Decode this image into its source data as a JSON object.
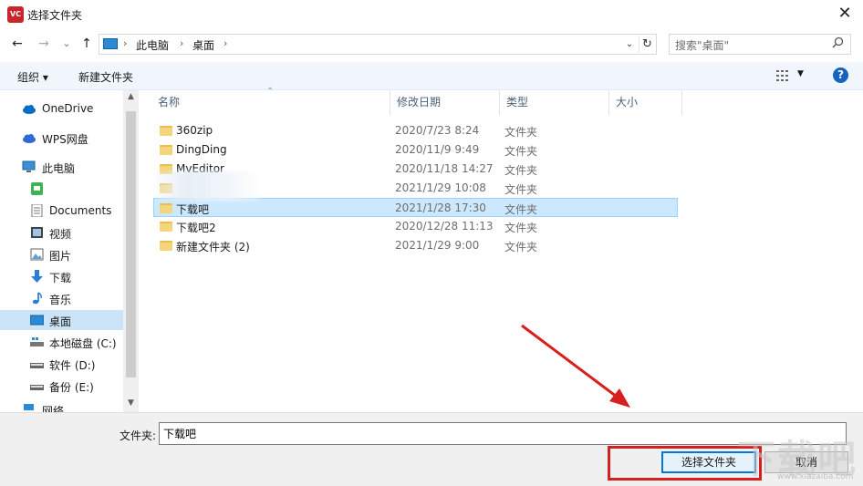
{
  "window": {
    "title": "选择文件夹",
    "app_icon_text": "VC",
    "close_glyph": "✕"
  },
  "nav": {
    "back": "←",
    "forward": "→",
    "recent": "⌄",
    "up": "↑",
    "breadcrumb": [
      "此电脑",
      "桌面"
    ],
    "search_placeholder": "搜索\"桌面\""
  },
  "toolbar": {
    "organize": "组织 ▾",
    "new_folder": "新建文件夹",
    "help": "?"
  },
  "sidebar": {
    "items": [
      {
        "label": "OneDrive",
        "icon": "cloud-icon"
      },
      {
        "label": "WPS网盘",
        "icon": "cloud-icon"
      },
      {
        "label": "此电脑",
        "icon": "computer-icon"
      },
      {
        "label": "",
        "icon": "wechat-icon"
      },
      {
        "label": "Documents",
        "icon": "document-icon"
      },
      {
        "label": "视频",
        "icon": "video-icon"
      },
      {
        "label": "图片",
        "icon": "picture-icon"
      },
      {
        "label": "下载",
        "icon": "download-icon"
      },
      {
        "label": "音乐",
        "icon": "music-icon"
      },
      {
        "label": "桌面",
        "icon": "desktop-icon",
        "selected": true
      },
      {
        "label": "本地磁盘 (C:)",
        "icon": "drive-icon"
      },
      {
        "label": "软件 (D:)",
        "icon": "drive-icon"
      },
      {
        "label": "备份 (E:)",
        "icon": "drive-icon"
      },
      {
        "label": "网络",
        "icon": "network-icon"
      }
    ]
  },
  "columns": {
    "name": "名称",
    "modified": "修改日期",
    "type": "类型",
    "size": "大小"
  },
  "files": [
    {
      "name": "360zip",
      "modified": "2020/7/23 8:24",
      "type": "文件夹"
    },
    {
      "name": "DingDing",
      "modified": "2020/11/9 9:49",
      "type": "文件夹"
    },
    {
      "name": "MvEditor",
      "modified": "2020/11/18 14:27",
      "type": "文件夹"
    },
    {
      "name": "",
      "modified": "2021/1/29 10:08",
      "type": "文件夹"
    },
    {
      "name": "下载吧",
      "modified": "2021/1/28 17:30",
      "type": "文件夹",
      "selected": true
    },
    {
      "name": "下载吧2",
      "modified": "2020/12/28 11:13",
      "type": "文件夹"
    },
    {
      "name": "新建文件夹 (2)",
      "modified": "2021/1/29 9:00",
      "type": "文件夹"
    }
  ],
  "footer": {
    "folder_label": "文件夹:",
    "folder_value": "下载吧",
    "select_button": "选择文件夹",
    "cancel_button": "取消"
  },
  "watermark": {
    "text": "下载吧",
    "sub": "www.xiazaiba.com"
  },
  "colors": {
    "accent": "#0078d7",
    "annotation": "#d81f1f",
    "selection": "#cce8ff"
  }
}
